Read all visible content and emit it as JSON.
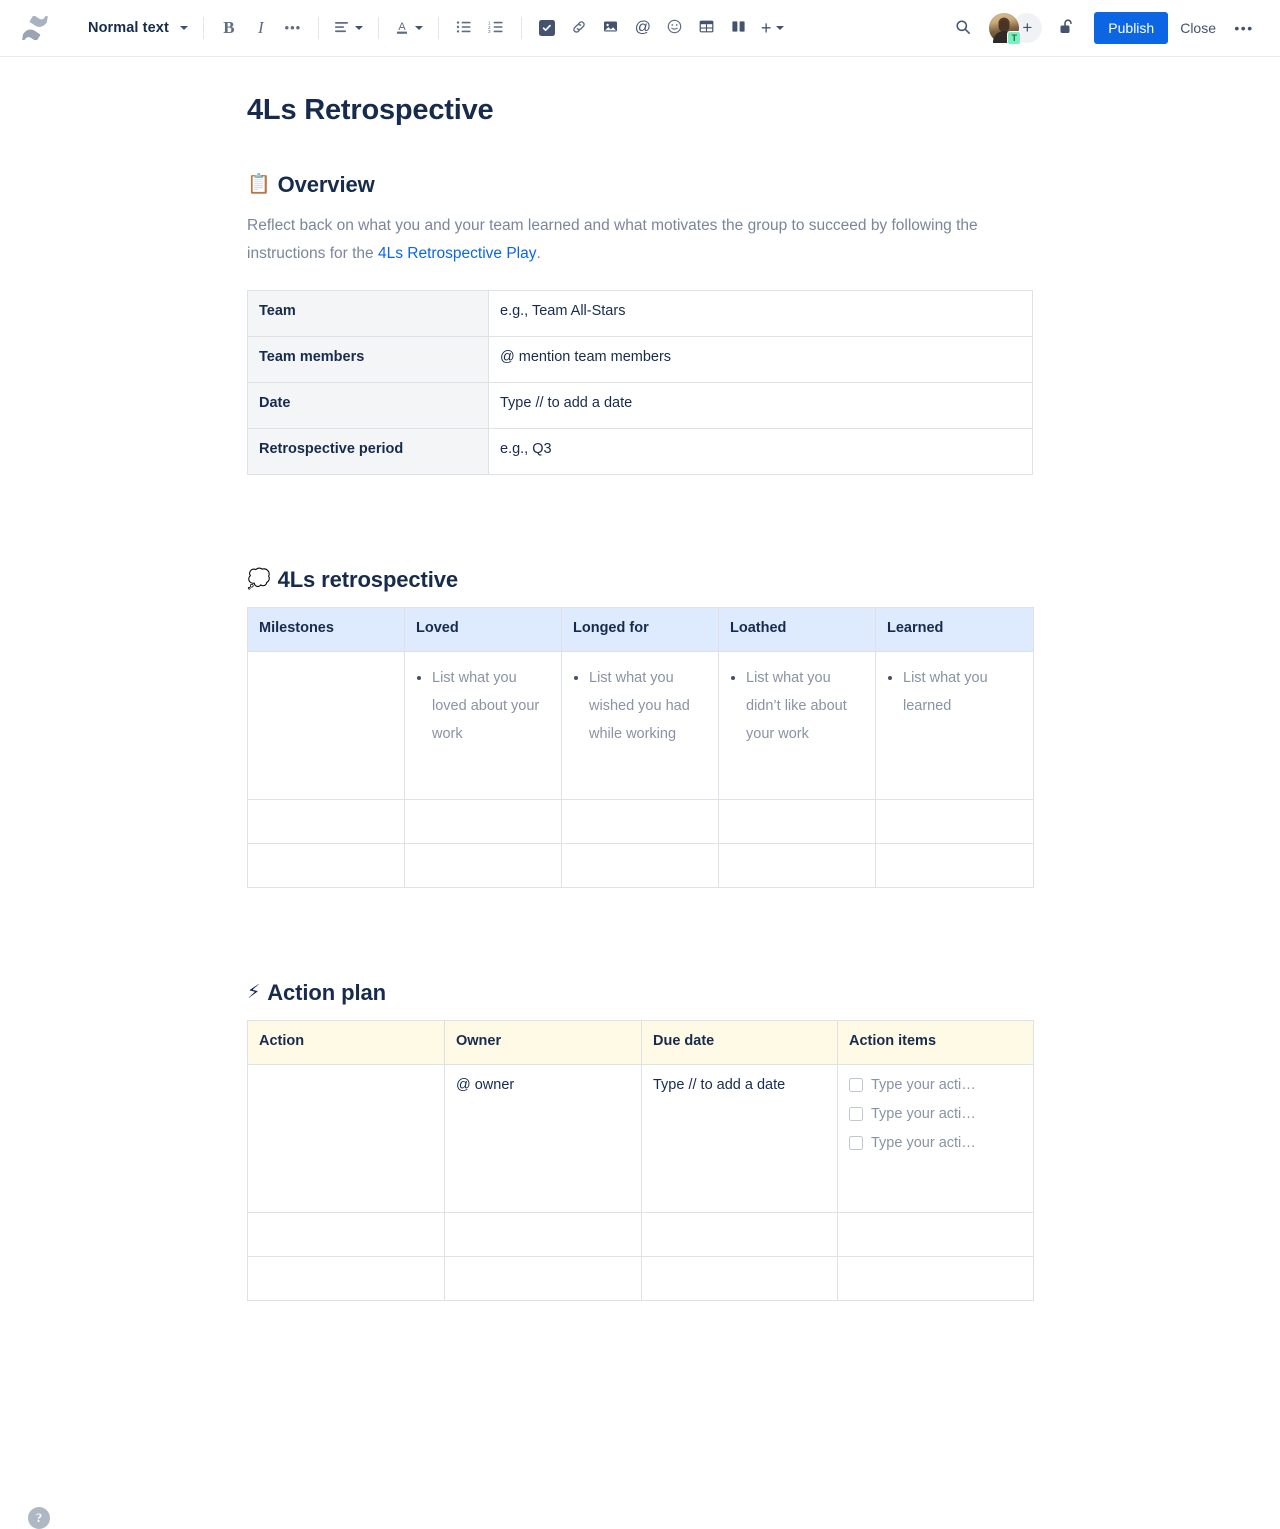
{
  "toolbar": {
    "logo_icon": "confluence-logo-icon",
    "text_style": "Normal text",
    "bold_label": "B",
    "italic_label": "I",
    "more_formatting_label": "•••",
    "align_icon": "text-align-icon",
    "text_color_label": "A",
    "bullet_list_icon": "bullet-list-icon",
    "numbered_list_icon": "numbered-list-icon",
    "task_list_icon": "checkbox-task-icon",
    "link_icon": "link-icon",
    "image_icon": "image-icon",
    "mention_icon": "mention-at-icon",
    "emoji_icon": "emoji-icon",
    "table_icon": "table-icon",
    "layout_icon": "page-layout-icon",
    "insert_icon": "plus-insert-icon",
    "search_icon": "search-icon",
    "avatar_badge": "T",
    "add_person_icon": "add-person-icon",
    "restrictions_icon": "unlock-padlock-icon",
    "publish_label": "Publish",
    "close_label": "Close",
    "more_actions_label": "•••"
  },
  "document": {
    "title": "4Ls Retrospective",
    "overview": {
      "emoji": "📋",
      "emoji_name": "clipboard-emoji",
      "heading": "Overview",
      "paragraph_before": "Reflect back on what you and your team learned and what motivates the group to succeed by following the instructions for the ",
      "link_text": "4Ls Retrospective Play",
      "paragraph_after": "."
    },
    "info_table": {
      "rows": [
        {
          "label": "Team",
          "value": "e.g., Team All-Stars"
        },
        {
          "label": "Team members",
          "value": "@ mention team members"
        },
        {
          "label": "Date",
          "value": "Type // to add a date"
        },
        {
          "label": "Retrospective period",
          "value": "e.g., Q3"
        }
      ]
    },
    "retro": {
      "emoji": "💭",
      "emoji_name": "thought-balloon-emoji",
      "heading": "4Ls retrospective",
      "headers": [
        "Milestones",
        "Loved",
        "Longed for",
        "Loathed",
        "Learned"
      ],
      "first_row": [
        "",
        "List what you loved about your work",
        "List what you wished you had while working",
        "List what you didn’t like about your work",
        "List what you learned"
      ],
      "empty_rows": 2
    },
    "action_plan": {
      "emoji": "⚡",
      "emoji_name": "high-voltage-emoji",
      "heading": "Action plan",
      "headers": [
        "Action",
        "Owner",
        "Due date",
        "Action items"
      ],
      "first_row": {
        "action": "",
        "owner": "@ owner",
        "due_date": "Type // to add a date",
        "action_items": [
          "Type your acti…",
          "Type your acti…",
          "Type your acti…"
        ]
      },
      "empty_rows": 2
    }
  },
  "footer": {
    "help_label": "?"
  },
  "colors": {
    "accent": "#0c66e4",
    "link": "#0c66e4",
    "retro_header_bg": "#deebff",
    "action_header_bg": "#fffae6",
    "info_header_bg": "#f4f5f7",
    "text": "#172b4d",
    "placeholder": "#8993a4"
  }
}
